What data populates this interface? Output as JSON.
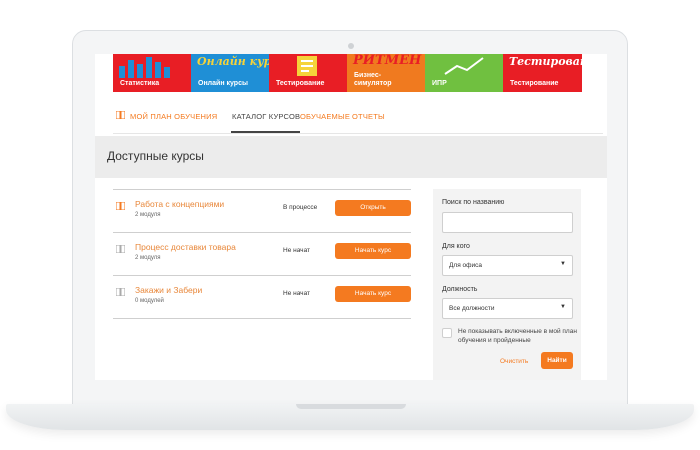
{
  "tiles": [
    {
      "label": "Статистика",
      "bg": "#e81e25",
      "art_text": ""
    },
    {
      "label": "Онлайн курсы",
      "bg": "#1f8fd6",
      "art_text": "Онлайн курсы"
    },
    {
      "label": "Тестирование",
      "bg": "#e81e25",
      "art_text": ""
    },
    {
      "label": "Бизнес-\nсимулятор",
      "bg": "#f07a1f",
      "art_text": "РИТМЕН"
    },
    {
      "label": "ИПР",
      "bg": "#70c040",
      "art_text": ""
    },
    {
      "label": "Тестирование",
      "bg": "#e81e25",
      "art_text": "Тестирование"
    }
  ],
  "nav": {
    "my_plan": "Мой план обучения",
    "catalog": "Каталог курсов",
    "learners": "Обучаемые",
    "reports": "Отчеты"
  },
  "heading": "Доступные курсы",
  "courses": [
    {
      "title": "Работа с концепциями",
      "modules": "2 модуля",
      "status": "В процессе",
      "action": "Открыть"
    },
    {
      "title": "Процесс доставки товара",
      "modules": "2 модуля",
      "status": "Не начат",
      "action": "Начать курс"
    },
    {
      "title": "Закажи и Забери",
      "modules": "0 модулей",
      "status": "Не начат",
      "action": "Начать курс"
    }
  ],
  "filter": {
    "search_label": "Поиск по названию",
    "search_value": "",
    "for_whom_label": "Для кого",
    "for_whom_value": "Для офиса",
    "position_label": "Должность",
    "position_value": "Все должности",
    "exclude_label": "Не показывать включенные в мой план обучения и пройденные",
    "clear": "Очистить",
    "find": "Найти"
  },
  "colors": {
    "accent": "#f47a20",
    "heading_bg": "#ececec",
    "filter_bg": "#f3f3f3"
  }
}
